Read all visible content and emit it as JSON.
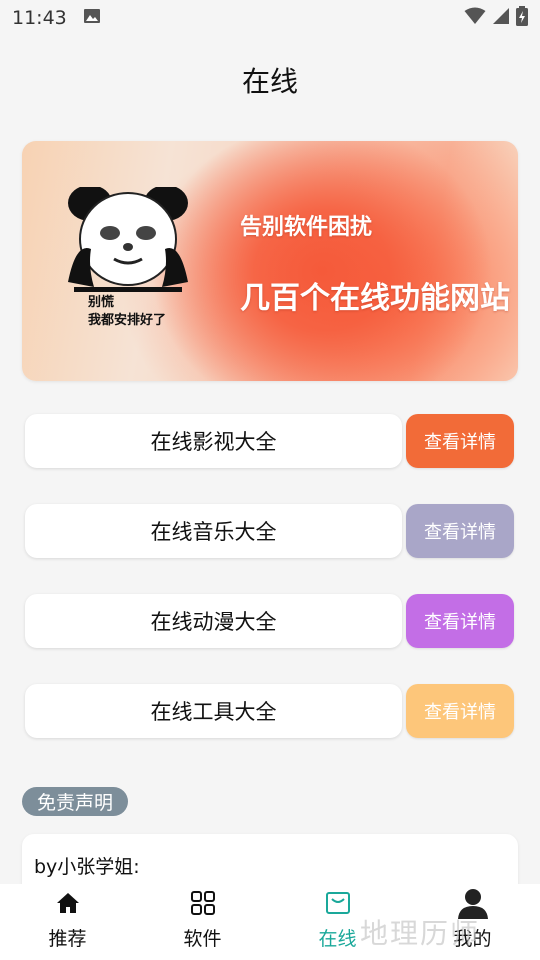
{
  "status_bar": {
    "time": "11:43"
  },
  "page": {
    "title": "在线"
  },
  "banner": {
    "meme_caption_line1": "别慌",
    "meme_caption_line2": "我都安排好了",
    "headline_small": "告别软件困扰",
    "headline_large": "几百个在线功能网站"
  },
  "categories": [
    {
      "label": "在线影视大全",
      "button": "查看详情",
      "color": "#f26b38"
    },
    {
      "label": "在线音乐大全",
      "button": "查看详情",
      "color": "#a9a6c8"
    },
    {
      "label": "在线动漫大全",
      "button": "查看详情",
      "color": "#c36ee6"
    },
    {
      "label": "在线工具大全",
      "button": "查看详情",
      "color": "#fdc67a"
    }
  ],
  "disclaimer": {
    "chip": "免责声明",
    "text": "by小张学姐:"
  },
  "bottom_nav": [
    {
      "label": "推荐",
      "icon": "home-icon"
    },
    {
      "label": "软件",
      "icon": "grid-icon"
    },
    {
      "label": "在线",
      "icon": "inbox-icon",
      "active": true
    },
    {
      "label": "我的",
      "icon": "person-icon"
    }
  ],
  "watermark": "地理历师",
  "colors": {
    "accent": "#1aa89a",
    "background": "#f5f5f5"
  }
}
